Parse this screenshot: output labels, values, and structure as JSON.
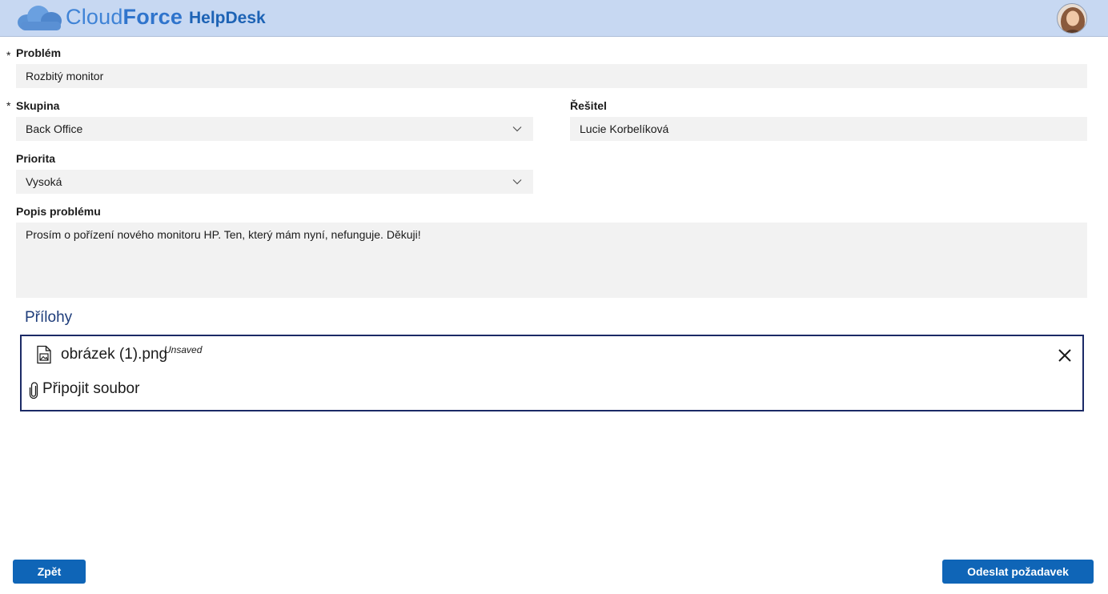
{
  "header": {
    "brand_light": "Cloud",
    "brand_bold": "Force",
    "app_name": "HelpDesk"
  },
  "form": {
    "problem": {
      "label": "Problém",
      "required_mark": "*",
      "value": "Rozbitý monitor"
    },
    "group": {
      "label": "Skupina",
      "required_mark": "*",
      "value": "Back Office"
    },
    "assignee": {
      "label": "Řešitel",
      "value": "Lucie Korbelíková"
    },
    "priority": {
      "label": "Priorita",
      "value": "Vysoká"
    },
    "description": {
      "label": "Popis problému",
      "value": "Prosím o pořízení nového monitoru HP. Ten, který mám nyní, nefunguje. Děkuji!"
    }
  },
  "attachments": {
    "title": "Přílohy",
    "files": [
      {
        "name": "obrázek (1).png",
        "status": "Unsaved"
      }
    ],
    "attach_label": "Připojit soubor"
  },
  "footer": {
    "back_label": "Zpět",
    "submit_label": "Odeslat požadavek"
  },
  "colors": {
    "header_bg": "#c7d8f2",
    "button_bg": "#0f65b7",
    "attachment_border": "#1b2a66"
  }
}
